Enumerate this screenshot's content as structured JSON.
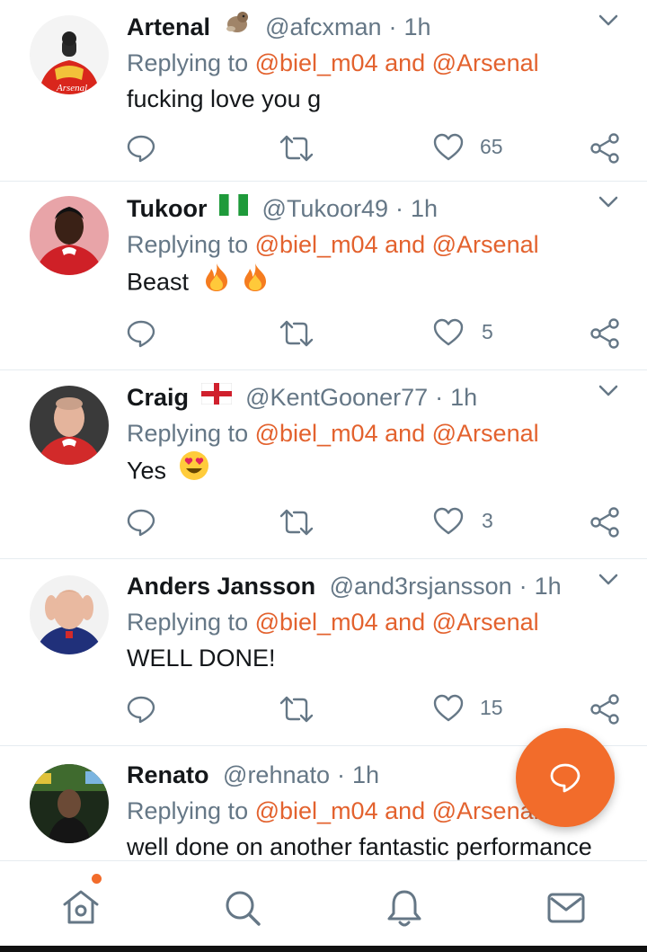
{
  "colors": {
    "accent": "#e3622e",
    "muted": "#657786",
    "text": "#14171a",
    "fab": "#f26c2b"
  },
  "tweets": [
    {
      "name": "Artenal",
      "badge_icon": "otter-emoji",
      "handle": "@afcxman",
      "separator": "·",
      "time": "1h",
      "replying_prefix": "Replying to",
      "mentions": "@biel_m04 and @Arsenal",
      "text": "fucking love you g",
      "text_emoji": "",
      "likes": "65"
    },
    {
      "name": "Tukoor",
      "badge_icon": "nigeria-flag-icon",
      "handle": "@Tukoor49",
      "separator": "·",
      "time": "1h",
      "replying_prefix": "Replying to",
      "mentions": "@biel_m04 and @Arsenal",
      "text": "Beast",
      "text_emoji": "fire-emoji x2",
      "likes": "5"
    },
    {
      "name": "Craig",
      "badge_icon": "england-flag-icon",
      "handle": "@KentGooner77",
      "separator": "·",
      "time": "1h",
      "replying_prefix": "Replying to",
      "mentions": "@biel_m04 and @Arsenal",
      "text": "Yes",
      "text_emoji": "heart-eyes-emoji",
      "likes": "3"
    },
    {
      "name": "Anders Jansson",
      "badge_icon": "",
      "handle": "@and3rsjansson",
      "separator": "·",
      "time": "1h",
      "replying_prefix": "Replying to",
      "mentions": "@biel_m04 and @Arsenal",
      "text": "WELL DONE!",
      "text_emoji": "",
      "likes": "15"
    },
    {
      "name": "Renato",
      "badge_icon": "",
      "handle": "@rehnato",
      "separator": "·",
      "time": "1h",
      "replying_prefix": "Replying to",
      "mentions": "@biel_m04 and @Arsenal",
      "text": "well done on another fantastic performance",
      "text_emoji": "",
      "likes": ""
    }
  ],
  "avatar_texts": {
    "artenal_shirt": "Arsenal"
  },
  "fab": {
    "icon": "compose-reply-icon"
  },
  "tabbar": [
    {
      "name": "home",
      "icon": "home-icon",
      "has_notification_dot": true
    },
    {
      "name": "search",
      "icon": "search-icon"
    },
    {
      "name": "notifications",
      "icon": "bell-icon"
    },
    {
      "name": "messages",
      "icon": "mail-icon"
    }
  ]
}
